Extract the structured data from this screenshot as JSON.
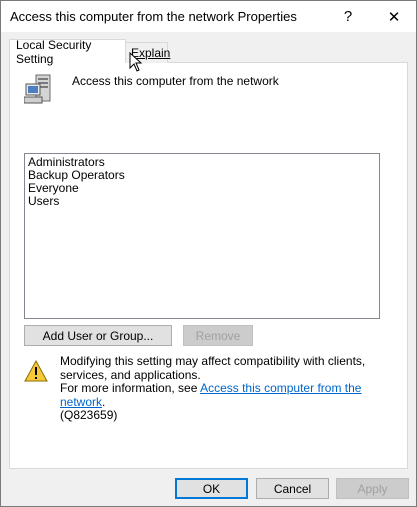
{
  "window": {
    "title": "Access this computer from the network Properties",
    "help_glyph": "?",
    "close_glyph": "✕"
  },
  "tabs": [
    {
      "label": "Local Security Setting",
      "active": true
    },
    {
      "label": "Explain",
      "active": false
    }
  ],
  "policy": {
    "icon": "server-computer-icon",
    "name": "Access this computer from the network"
  },
  "accounts": [
    "Administrators",
    "Backup Operators",
    "Everyone",
    "Users"
  ],
  "actions": {
    "add_label": "Add User or Group...",
    "remove_label": "Remove",
    "remove_enabled": false
  },
  "warning": {
    "icon": "warning-icon",
    "line1": "Modifying this setting may affect compatibility with clients, services, and applications.",
    "line2_prefix": "For more information, see ",
    "link_text": "Access this computer from the network",
    "line2_suffix": ".",
    "kb": "(Q823659)"
  },
  "footer": {
    "ok_label": "OK",
    "cancel_label": "Cancel",
    "apply_label": "Apply",
    "apply_enabled": false
  },
  "colors": {
    "link": "#0066cc",
    "default_button_border": "#0078d7"
  }
}
